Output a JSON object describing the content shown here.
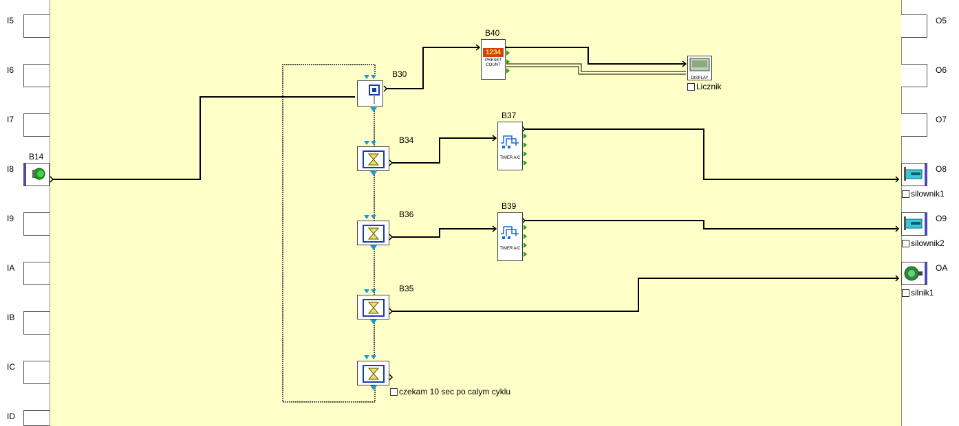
{
  "inputs": [
    "I5",
    "I6",
    "I7",
    "I8",
    "I9",
    "IA",
    "IB",
    "IC",
    "ID"
  ],
  "outputs": [
    "O5",
    "O6",
    "O7",
    "O8",
    "O9",
    "OA"
  ],
  "blocks": {
    "b14": "B14",
    "b30": "B30",
    "b34": "B34",
    "b36": "B36",
    "b35": "B35",
    "b40": "B40",
    "b37": "B37",
    "b39": "B39"
  },
  "counter": {
    "digits": "1234",
    "line1": "PRESET",
    "line2": "COUNT"
  },
  "timer_caption": "TIMER A/C",
  "display_caption": "DISPLAY",
  "comments": {
    "display": "Licznik",
    "o8": "silownik1",
    "o9": "silownik2",
    "oa": "silnik1",
    "last_timer": "czekam 10 sec po calym cyklu"
  }
}
